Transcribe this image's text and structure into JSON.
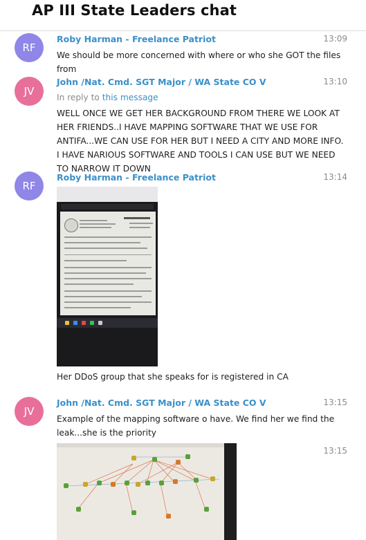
{
  "chat": {
    "title": "AP III State Leaders chat"
  },
  "messages": [
    {
      "avatar": "RF",
      "sender": "Roby Harman - Freelance Patriot",
      "time": "13:09",
      "text": "We should be more concerned with where or who she GOT the files from"
    },
    {
      "avatar": "JV",
      "sender": "John /Nat. Cmd. SGT Major / WA State CO V",
      "time": "13:10",
      "reply_prefix": "In reply to",
      "reply_link": "this message",
      "text": "WELL ONCE WE GET HER BACKGROUND FROM THERE WE LOOK AT HER FRIENDS..I HAVE MAPPING SOFTWARE THAT WE USE FOR ANTIFA...WE CAN USE FOR HER BUT I NEED A CITY AND MORE INFO. I HAVE NARIOUS SOFTWARE AND TOOLS I CAN USE BUT WE NEED TO NARROW IT DOWN"
    },
    {
      "avatar": "RF",
      "sender": "Roby Harman - Freelance Patriot",
      "time": "13:14",
      "image": "document-photo",
      "caption": "Her DDoS group that she speaks for is registered in CA"
    },
    {
      "avatar": "JV",
      "sender": "John /Nat. Cmd. SGT Major / WA State CO V",
      "time": "13:15",
      "text": "Example of the mapping software o have. We find her we find the leak...she is the priority"
    },
    {
      "time": "13:15",
      "image": "mapping-software-photo"
    }
  ],
  "colors": {
    "accent": "#3a8fc9",
    "avatar_rf": "#8f86e8",
    "avatar_jv": "#e86f9a"
  }
}
